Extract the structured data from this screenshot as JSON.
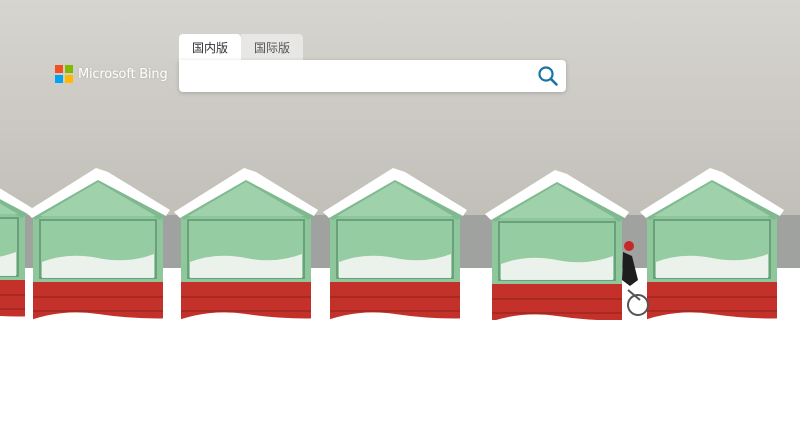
{
  "brand": {
    "name": "Microsoft Bing",
    "logo_colors": [
      "#f25022",
      "#7fba00",
      "#00a4ef",
      "#ffb900"
    ]
  },
  "search": {
    "tabs": [
      {
        "label": "国内版",
        "active": true
      },
      {
        "label": "国际版",
        "active": false
      }
    ],
    "value": "",
    "placeholder": "",
    "button_icon": "search-icon",
    "accent": "#1a73a8"
  },
  "background": {
    "subject": "snow-covered green and red beach huts",
    "colors": {
      "sky": "#c8c6bf",
      "hut_green": "#8dc49a",
      "hut_red": "#c8322b",
      "snow": "#ffffff"
    }
  }
}
